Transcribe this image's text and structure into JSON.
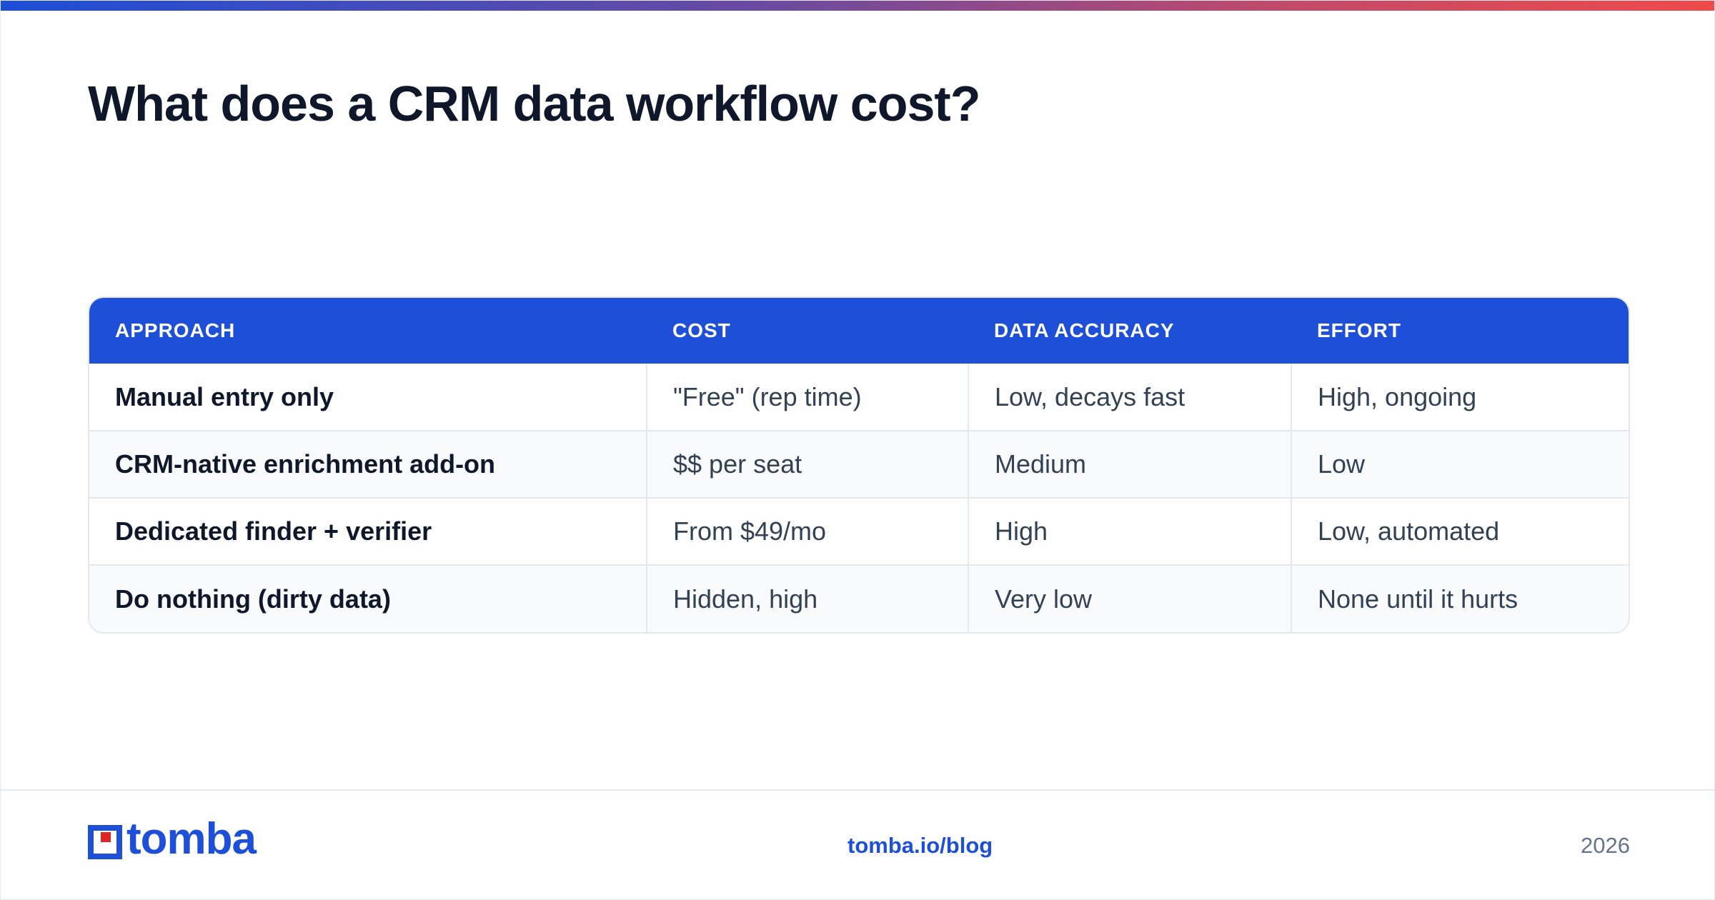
{
  "page": {
    "title": "What does a CRM data workflow cost?"
  },
  "table": {
    "headers": [
      "APPROACH",
      "COST",
      "DATA ACCURACY",
      "EFFORT"
    ],
    "rows": [
      [
        "Manual entry only",
        "\"Free\" (rep time)",
        "Low, decays fast",
        "High, ongoing"
      ],
      [
        "CRM-native enrichment add-on",
        "$$ per seat",
        "Medium",
        "Low"
      ],
      [
        "Dedicated finder + verifier",
        "From $49/mo",
        "High",
        "Low, automated"
      ],
      [
        "Do nothing (dirty data)",
        "Hidden, high",
        "Very low",
        "None until it hurts"
      ]
    ]
  },
  "footer": {
    "logo_text": "tomba",
    "link": "tomba.io/blog",
    "year": "2026"
  },
  "colors": {
    "accent": "#1d4fd8",
    "logo_red": "#e02424",
    "title": "#0f172a"
  }
}
